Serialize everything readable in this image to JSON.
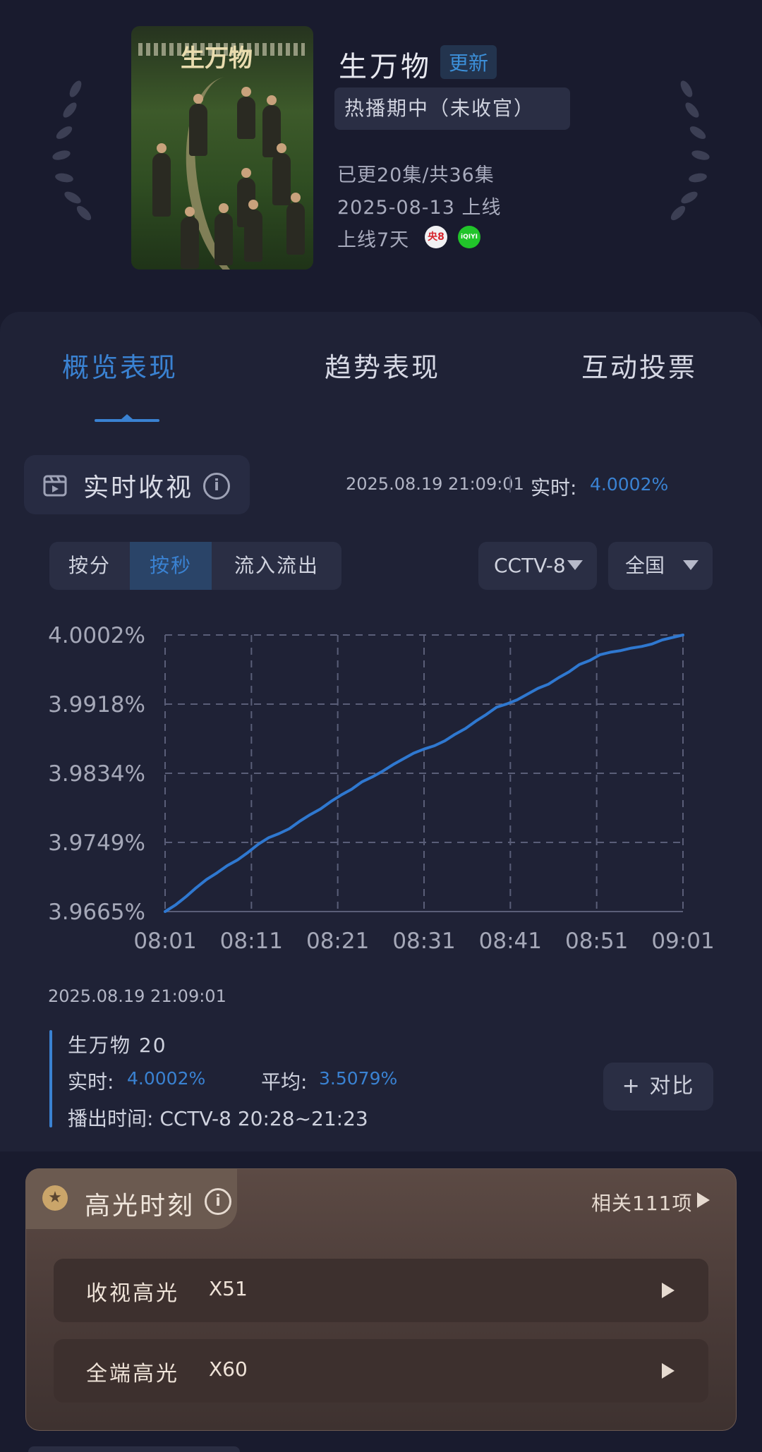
{
  "show": {
    "poster_title": "生万物",
    "title": "生万物",
    "update_badge": "更新",
    "status": "热播期中（未收官）",
    "episodes": "已更20集/共36集",
    "premiere": "2025-08-13 上线",
    "days_online": "上线7天",
    "channels": [
      {
        "name": "央8",
        "icon": "cctv8-icon",
        "color": "#d7262e"
      },
      {
        "name": "iQIYI",
        "icon": "iqiyi-icon",
        "color": "#21c42a"
      }
    ]
  },
  "tabs": [
    "概览表现",
    "趋势表现",
    "互动投票"
  ],
  "realtime": {
    "title": "实时收视",
    "timestamp": "2025.08.19 21:09:01",
    "label": "实时:",
    "value": "4.0002%"
  },
  "segments": [
    "按分",
    "按秒",
    "流入流出"
  ],
  "filters": {
    "channel": "CCTV-8",
    "region": "全国"
  },
  "chart_data": {
    "type": "line",
    "x": [
      "08:01",
      "08:11",
      "08:21",
      "08:31",
      "08:41",
      "08:51",
      "09:01"
    ],
    "y_ticks": [
      "4.0002%",
      "3.9918%",
      "3.9834%",
      "3.9749%",
      "3.9665%"
    ],
    "ylim": [
      3.9665,
      4.0002
    ],
    "grid": true,
    "series": [
      {
        "color": "#2f78d0",
        "points": [
          [
            0,
            3.9665
          ],
          [
            1,
            3.9673
          ],
          [
            2,
            3.9683
          ],
          [
            3,
            3.9694
          ],
          [
            4,
            3.9704
          ],
          [
            5,
            3.9712
          ],
          [
            6,
            3.9721
          ],
          [
            7,
            3.9728
          ],
          [
            8,
            3.9737
          ],
          [
            9,
            3.9747
          ],
          [
            10,
            3.9755
          ],
          [
            11,
            3.976
          ],
          [
            12,
            3.9766
          ],
          [
            13,
            3.9775
          ],
          [
            14,
            3.9783
          ],
          [
            15,
            3.979
          ],
          [
            16,
            3.9799
          ],
          [
            17,
            3.9807
          ],
          [
            18,
            3.9814
          ],
          [
            19,
            3.9823
          ],
          [
            20,
            3.9829
          ],
          [
            21,
            3.9836
          ],
          [
            22,
            3.9844
          ],
          [
            23,
            3.9851
          ],
          [
            24,
            3.9858
          ],
          [
            25,
            3.9863
          ],
          [
            26,
            3.9867
          ],
          [
            27,
            3.9873
          ],
          [
            28,
            3.9881
          ],
          [
            29,
            3.9888
          ],
          [
            30,
            3.9897
          ],
          [
            31,
            3.9905
          ],
          [
            32,
            3.9914
          ],
          [
            33,
            3.9918
          ],
          [
            34,
            3.9923
          ],
          [
            35,
            3.993
          ],
          [
            36,
            3.9937
          ],
          [
            37,
            3.9942
          ],
          [
            38,
            3.995
          ],
          [
            39,
            3.9957
          ],
          [
            40,
            3.9966
          ],
          [
            41,
            3.9971
          ],
          [
            42,
            3.9978
          ],
          [
            43,
            3.9981
          ],
          [
            44,
            3.9983
          ],
          [
            45,
            3.9986
          ],
          [
            46,
            3.9988
          ],
          [
            47,
            3.9991
          ],
          [
            48,
            3.9996
          ],
          [
            49,
            3.9999
          ],
          [
            50,
            4.0002
          ]
        ]
      }
    ]
  },
  "detail": {
    "timestamp": "2025.08.19 21:09:01",
    "episode": "生万物 20",
    "realtime_label": "实时:",
    "realtime_value": "4.0002%",
    "avg_label": "平均:",
    "avg_value": "3.5079%",
    "airtime": "播出时间: CCTV-8 20:28~21:23",
    "compare_button": "+ 对比"
  },
  "highlights": {
    "title": "高光时刻",
    "related": "相关111项",
    "rows": [
      {
        "label": "收视高光",
        "count": "X51"
      },
      {
        "label": "全端高光",
        "count": "X60"
      }
    ]
  }
}
